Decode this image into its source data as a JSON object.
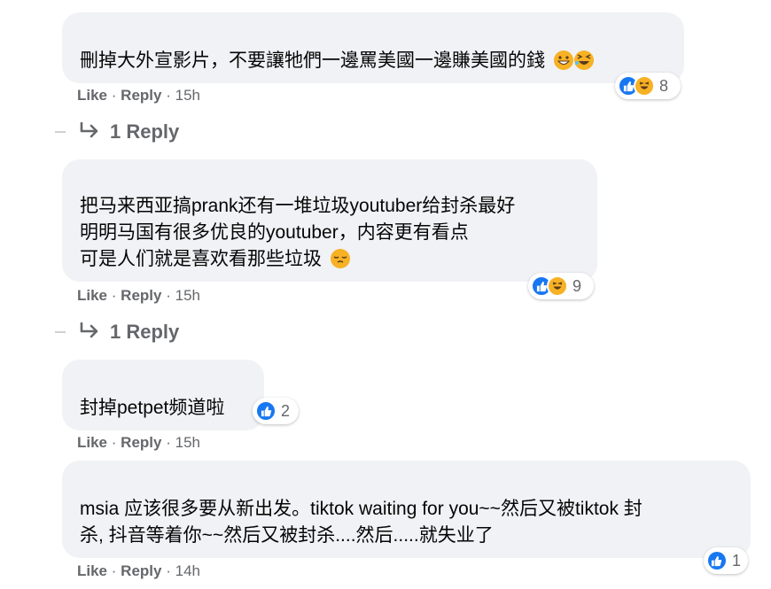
{
  "comments": [
    {
      "lines": [
        "刪掉大外宣影片，不要讓牠們一邊罵美國一邊賺美國的錢"
      ],
      "like_label": "Like",
      "reply_label": "Reply",
      "separator": "·",
      "time": "15h",
      "reaction_count": "8",
      "reply_link": "1 Reply"
    },
    {
      "lines": [
        "把马来西亚搞prank还有一堆垃圾youtuber给封杀最好",
        "明明马国有很多优良的youtuber，内容更有看点",
        "可是人们就是喜欢看那些垃圾"
      ],
      "like_label": "Like",
      "reply_label": "Reply",
      "separator": "·",
      "time": "15h",
      "reaction_count": "9",
      "reply_link": "1 Reply"
    },
    {
      "lines": [
        "封掉petpet频道啦"
      ],
      "like_label": "Like",
      "reply_label": "Reply",
      "separator": "·",
      "time": "15h",
      "reaction_count": "2"
    },
    {
      "lines": [
        "msia 应该很多要从新出发。tiktok waiting for you~~然后又被tiktok 封",
        "杀, 抖音等着你~~然后又被封杀....然后.....就失业了"
      ],
      "like_label": "Like",
      "reply_label": "Reply",
      "separator": "·",
      "time": "14h",
      "reaction_count": "1"
    }
  ],
  "colors": {
    "bubble": "#f0f2f5",
    "meta_text": "#65676b",
    "like_blue": "#1877f2",
    "haha_yellow": "#f7b125"
  },
  "icons": [
    "reply-arrow-icon",
    "like-reaction-icon",
    "haha-reaction-icon",
    "grinning-emoji-icon",
    "laughing-emoji-icon",
    "pensive-emoji-icon"
  ]
}
